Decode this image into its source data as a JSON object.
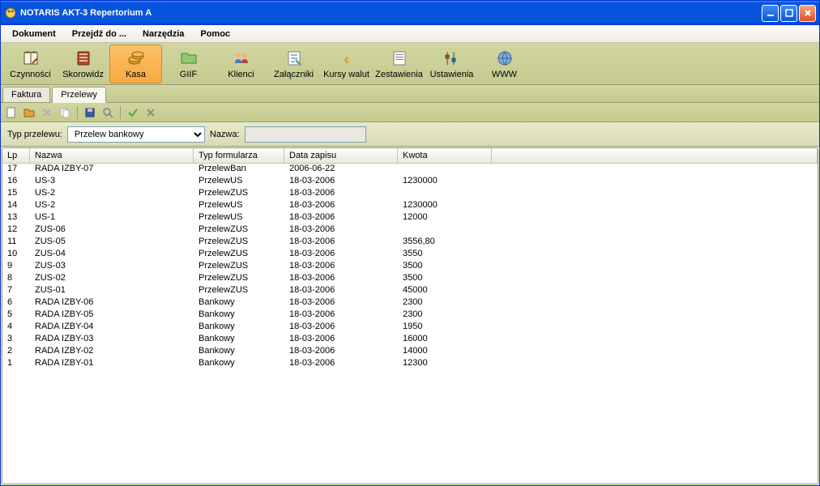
{
  "window": {
    "title": "NOTARIS AKT-3 Repertorium A"
  },
  "menu": {
    "dokument": "Dokument",
    "przejdz": "Przejdź do ...",
    "narzedzia": "Narzędzia",
    "pomoc": "Pomoc"
  },
  "toolbar": {
    "czynnosci": "Czynności",
    "skorowidz": "Skorowidz",
    "kasa": "Kasa",
    "giif": "GIIF",
    "klienci": "Klienci",
    "zalaczniki": "Załączniki",
    "kursy": "Kursy walut",
    "zestawienia": "Zestawienia",
    "ustawienia": "Ustawienia",
    "www": "WWW"
  },
  "tabs": {
    "faktura": "Faktura",
    "przelewy": "Przelewy"
  },
  "filter": {
    "typ_label": "Typ przelewu:",
    "typ_value": "Przelew bankowy",
    "nazwa_label": "Nazwa:",
    "nazwa_value": ""
  },
  "columns": {
    "lp": "Lp",
    "nazwa": "Nazwa",
    "typ": "Typ formularza",
    "data": "Data zapisu",
    "kwota": "Kwota"
  },
  "rows": [
    {
      "lp": "17",
      "nazwa": "RADA IZBY-07",
      "typ": "PrzelewBan",
      "data": "2006-06-22",
      "kwota": ""
    },
    {
      "lp": "16",
      "nazwa": "US-3",
      "typ": "PrzelewUS",
      "data": "18-03-2006",
      "kwota": "1230000"
    },
    {
      "lp": "15",
      "nazwa": "US-2",
      "typ": "PrzelewZUS",
      "data": "18-03-2006",
      "kwota": ""
    },
    {
      "lp": "14",
      "nazwa": "US-2",
      "typ": "PrzelewUS",
      "data": "18-03-2006",
      "kwota": "1230000"
    },
    {
      "lp": "13",
      "nazwa": "US-1",
      "typ": "PrzelewUS",
      "data": "18-03-2006",
      "kwota": "12000"
    },
    {
      "lp": "12",
      "nazwa": "ZUS-06",
      "typ": "PrzelewZUS",
      "data": "18-03-2006",
      "kwota": ""
    },
    {
      "lp": "11",
      "nazwa": "ZUS-05",
      "typ": "PrzelewZUS",
      "data": "18-03-2006",
      "kwota": "3556,80"
    },
    {
      "lp": "10",
      "nazwa": "ZUS-04",
      "typ": "PrzelewZUS",
      "data": "18-03-2006",
      "kwota": "3550"
    },
    {
      "lp": "9",
      "nazwa": "ZUS-03",
      "typ": "PrzelewZUS",
      "data": "18-03-2006",
      "kwota": "3500"
    },
    {
      "lp": "8",
      "nazwa": "ZUS-02",
      "typ": "PrzelewZUS",
      "data": "18-03-2006",
      "kwota": "3500"
    },
    {
      "lp": "7",
      "nazwa": "ZUS-01",
      "typ": "PrzelewZUS",
      "data": "18-03-2006",
      "kwota": "45000"
    },
    {
      "lp": "6",
      "nazwa": "RADA IZBY-06",
      "typ": "Bankowy",
      "data": "18-03-2006",
      "kwota": "2300"
    },
    {
      "lp": "5",
      "nazwa": "RADA IZBY-05",
      "typ": "Bankowy",
      "data": "18-03-2006",
      "kwota": "2300"
    },
    {
      "lp": "4",
      "nazwa": "RADA IZBY-04",
      "typ": "Bankowy",
      "data": "18-03-2006",
      "kwota": "1950"
    },
    {
      "lp": "3",
      "nazwa": "RADA IZBY-03",
      "typ": "Bankowy",
      "data": "18-03-2006",
      "kwota": "16000"
    },
    {
      "lp": "2",
      "nazwa": "RADA IZBY-02",
      "typ": "Bankowy",
      "data": "18-03-2006",
      "kwota": "14000"
    },
    {
      "lp": "1",
      "nazwa": "RADA IZBY-01",
      "typ": "Bankowy",
      "data": "18-03-2006",
      "kwota": "12300"
    }
  ]
}
